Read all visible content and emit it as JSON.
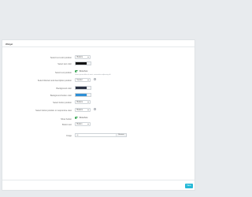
{
  "panel": {
    "title": "Widget"
  },
  "rows": [
    {
      "label": "Select text color position",
      "type": "select",
      "value": "Bottom"
    },
    {
      "label": "Select text color",
      "type": "color",
      "color": "#111111"
    },
    {
      "label": "Select text position",
      "type": "toggle",
      "toggle_label": "Slideshow",
      "help": "Lorem ipsum dolor sit amet, consectetur adipiscing elit"
    },
    {
      "label": "Select title/text and description position",
      "type": "select",
      "value": "Center"
    },
    {
      "label": "Background color",
      "type": "color",
      "color": "#2a3042"
    },
    {
      "label": "Background button color",
      "type": "color",
      "color": "#2e8fd6"
    },
    {
      "label": "Select button position",
      "type": "select",
      "value": "Bottom"
    },
    {
      "label": "Select button position on responsive view",
      "type": "select",
      "value": "Bottom"
    },
    {
      "label": "Show button",
      "type": "toggle",
      "toggle_label": "Slideshow"
    },
    {
      "label": "Button text",
      "type": "select",
      "value": "Button"
    },
    {
      "label": "Image",
      "type": "file",
      "button_label": "Browse"
    }
  ],
  "footer": {
    "save_label": "Save"
  },
  "icons": {
    "help": "help-circle-icon",
    "file": "file-icon"
  },
  "colors": {
    "accent": "#25b9d7",
    "toggle_on": "#3aa655"
  }
}
